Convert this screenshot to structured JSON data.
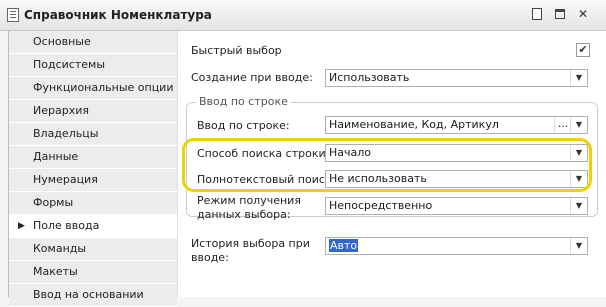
{
  "window": {
    "title": "Справочник Номенклатура"
  },
  "nav": {
    "items": [
      {
        "label": "Основные",
        "active": false
      },
      {
        "label": "Подсистемы",
        "active": false
      },
      {
        "label": "Функциональные опции",
        "active": false
      },
      {
        "label": "Иерархия",
        "active": false
      },
      {
        "label": "Владельцы",
        "active": false
      },
      {
        "label": "Данные",
        "active": false
      },
      {
        "label": "Нумерация",
        "active": false
      },
      {
        "label": "Формы",
        "active": false
      },
      {
        "label": "Поле ввода",
        "active": true
      },
      {
        "label": "Команды",
        "active": false
      },
      {
        "label": "Макеты",
        "active": false
      },
      {
        "label": "Ввод на основании",
        "active": false
      }
    ]
  },
  "form": {
    "quick_choice": {
      "label": "Быстрый выбор",
      "checked": true,
      "mark": "✔"
    },
    "create_on_input": {
      "label": "Создание при вводе:",
      "value": "Использовать"
    },
    "input_by_string_group": {
      "caption": "Ввод по строке"
    },
    "input_by_string": {
      "label": "Ввод по строке:",
      "value": "Наименование, Код, Артикул",
      "more": "..."
    },
    "search_method": {
      "label": "Способ поиска строки:",
      "value": "Начало"
    },
    "fulltext_search": {
      "label": "Полнотекстовый поиск:",
      "value": "Не использовать"
    },
    "data_retrieval_mode": {
      "label_line1": "Режим получения",
      "label_line2": "данных выбора:",
      "value": "Непосредственно"
    },
    "choice_history": {
      "label_line1": "История выбора при",
      "label_line2": "вводе:",
      "value": "Авто"
    }
  },
  "colors": {
    "highlight": "#f0d000",
    "selection": "#3366cc"
  },
  "icons": {
    "dropdown": "▼",
    "current_item": "▶",
    "close": "✕"
  }
}
